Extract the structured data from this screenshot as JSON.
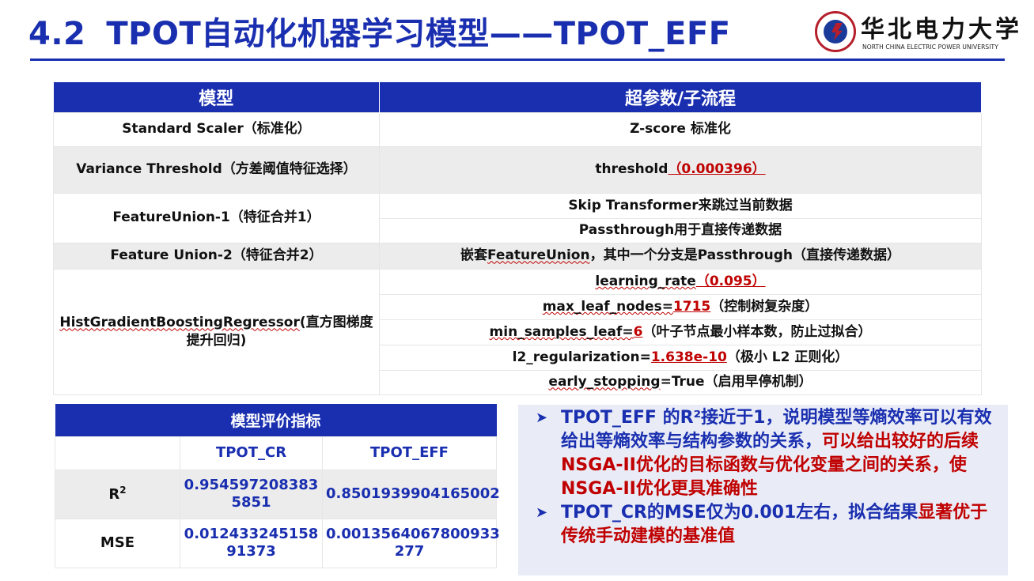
{
  "header": {
    "section_number": "4.2",
    "title": "TPOT自动化机器学习模型——TPOT_EFF",
    "logo_cn": "华北电力大学",
    "logo_en": "NORTH CHINA ELECTRIC POWER UNIVERSITY"
  },
  "model_table": {
    "headers": [
      "模型",
      "超参数/子流程"
    ],
    "rows": {
      "scaler": {
        "model": "Standard Scaler（标准化）",
        "param": "Z-score 标准化"
      },
      "variance": {
        "model": "Variance Threshold（方差阈值特征选择）",
        "param_prefix": "threshold",
        "param_value": "（0.000396）"
      },
      "union1": {
        "model": "FeatureUnion-1（特征合并1）",
        "params": [
          "Skip Transformer来跳过当前数据",
          "Passthrough用于直接传递数据"
        ]
      },
      "union2": {
        "model": "Feature Union-2（特征合并2）",
        "param_a": "嵌套",
        "param_b": "FeatureUnion",
        "param_c": "，其中一个分支是Passthrough（直接传递数据）"
      },
      "hgbr": {
        "model_a": "HistGradientBoostingRegressor",
        "model_b": "(直方图梯度提升回归)",
        "params": [
          {
            "name": "learning_rate",
            "value": "（0.095）",
            "suffix": ""
          },
          {
            "name": "max_leaf_nodes=",
            "value": "1715",
            "suffix": "（控制树复杂度）"
          },
          {
            "name": "min_samples_leaf=",
            "value": "6",
            "suffix": "（叶子节点最小样本数，防止过拟合）"
          },
          {
            "name": "l2_regularization=",
            "value": "1.638e-10",
            "suffix": "（极小 L2 正则化）"
          },
          {
            "name": "early_stopping",
            "value": "",
            "suffix": "=True（启用早停机制）"
          }
        ]
      }
    }
  },
  "metrics_table": {
    "title": "模型评价指标",
    "columns": [
      "TPOT_CR",
      "TPOT_EFF"
    ],
    "rows": [
      {
        "label_base": "R",
        "label_sup": "2",
        "cr": "0.954597208383 5851",
        "eff": "0.8501939904165002"
      },
      {
        "label_base": "MSE",
        "label_sup": "",
        "cr": "0.012433245158 91373",
        "eff": "0.0013564067800933 277"
      }
    ]
  },
  "notes": [
    {
      "plain": "TPOT_EFF 的R²接近于1，说明模型等熵效率可以有效给出等熵效率与结构参数的关系，",
      "highlight": "可以给出较好的后续NSGA-II优化的目标函数与优化变量之间的关系，使NSGA-II优化更具准确性"
    },
    {
      "plain": "TPOT_CR的MSE仅为0.001左右，拟合结果",
      "highlight": "显著优于传统手动建模的基准值"
    }
  ],
  "colors": {
    "primary": "#1a2fb0",
    "accent": "#c00000",
    "row_alt": "#ececec",
    "note_bg": "#e9ecf6"
  }
}
